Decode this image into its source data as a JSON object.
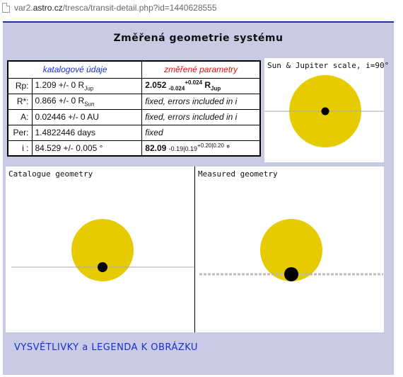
{
  "browser": {
    "url_host_prefix": "var2.",
    "url_host": "astro.cz",
    "url_path": "/tresca/transit-detail.php?id=1440628555"
  },
  "page": {
    "title": "Změřená geometrie systému",
    "legend_link": "VYSVĚTLIVKY a LEGENDA K OBRÁZKU"
  },
  "table": {
    "header_catalog": "katalogové údaje",
    "header_measured": "změřené parametry",
    "rows": {
      "rp": {
        "label": "Rp:",
        "catalog": "1.209 +/- 0 R",
        "catalog_sub": "Jup",
        "measured_main": "2.052",
        "measured_minus": "-0.024",
        "measured_plus": "+0.024",
        "measured_unit": "R",
        "measured_unit_sub": "Jup"
      },
      "rstar": {
        "label": "R*:",
        "catalog": "0.866 +/- 0 R",
        "catalog_sub": "Sun",
        "measured": "fixed, errors included in i"
      },
      "a": {
        "label": "A:",
        "catalog": "0.02446 +/- 0 AU",
        "measured": "fixed, errors included in i"
      },
      "per": {
        "label": "Per:",
        "catalog": "1.4822446 days",
        "measured": "fixed"
      },
      "i": {
        "label": "i :",
        "catalog": "84.529 +/- 0.005 °",
        "measured_main": "82.09",
        "measured_minus": "-0.19|0.19",
        "measured_plus": "+0.20|0.20",
        "measured_unit": "°"
      }
    }
  },
  "panels": {
    "scale_caption": "Sun & Jupiter scale, i=90°",
    "catalog_caption": "Catalogue geometry",
    "measured_caption": "Measured geometry"
  },
  "colors": {
    "star": "#e5cb00",
    "planet": "#000000",
    "frame_bg": "#c9cbe5",
    "link": "#1a2fd0",
    "measured_header": "#e01010"
  }
}
